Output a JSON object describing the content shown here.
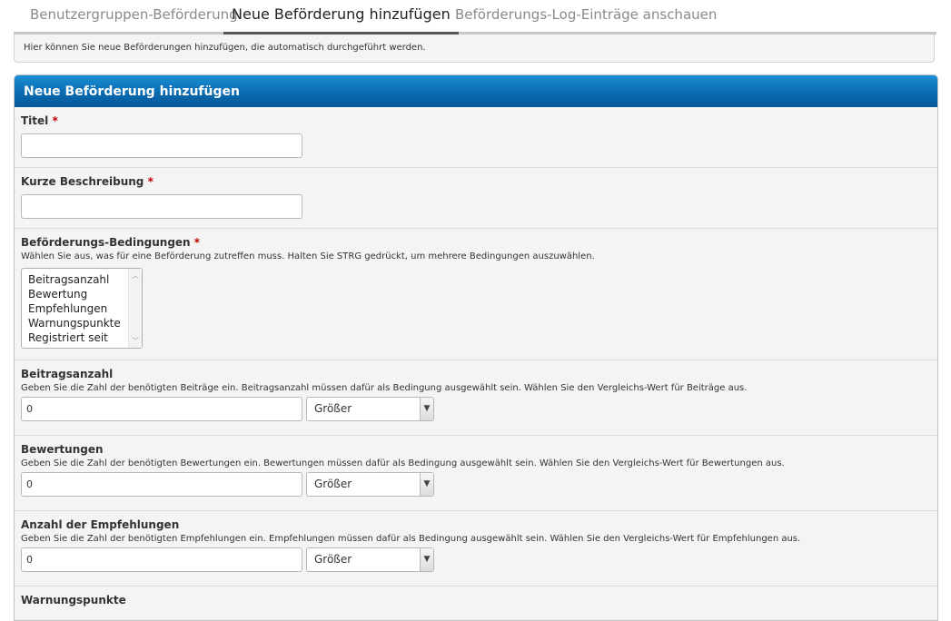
{
  "tabs": [
    {
      "label": "Benutzergruppen-Beförderung"
    },
    {
      "label": "Neue Beförderung hinzufügen"
    },
    {
      "label": "Beförderungs-Log-Einträge anschauen"
    }
  ],
  "info_text": "Hier können Sie neue Beförderungen hinzufügen, die automatisch durchgeführt werden.",
  "panel": {
    "title": "Neue Beförderung hinzufügen",
    "required_mark": "*",
    "fields": {
      "title": {
        "label": "Titel",
        "value": ""
      },
      "short_description": {
        "label": "Kurze Beschreibung",
        "value": ""
      },
      "conditions": {
        "label": "Beförderungs-Bedingungen",
        "description": "Wählen Sie aus, was für eine Beförderung zutreffen muss. Halten Sie STRG gedrückt, um mehrere Bedingungen auszuwählen.",
        "options": [
          "Beitragsanzahl",
          "Bewertung",
          "Empfehlungen",
          "Warnungspunkte",
          "Registriert seit"
        ]
      },
      "post_count": {
        "label": "Beitragsanzahl",
        "description": "Geben Sie die Zahl der benötigten Beiträge ein. Beitragsanzahl müssen dafür als Bedingung ausgewählt sein. Wählen Sie den Vergleichs-Wert für Beiträge aus.",
        "value": "0",
        "comparison": "Größer"
      },
      "ratings": {
        "label": "Bewertungen",
        "description": "Geben Sie die Zahl der benötigten Bewertungen ein. Bewertungen müssen dafür als Bedingung ausgewählt sein. Wählen Sie den Vergleichs-Wert für Bewertungen aus.",
        "value": "0",
        "comparison": "Größer"
      },
      "referrals": {
        "label": "Anzahl der Empfehlungen",
        "description": "Geben Sie die Zahl der benötigten Empfehlungen ein. Empfehlungen müssen dafür als Bedingung ausgewählt sein. Wählen Sie den Vergleichs-Wert für Empfehlungen aus.",
        "value": "0",
        "comparison": "Größer"
      },
      "warning_points": {
        "label": "Warnungspunkte"
      }
    }
  },
  "icons": {
    "select_arrow": "chevron-down-icon",
    "scroll_up": "scroll-up-icon",
    "scroll_down": "scroll-down-icon"
  },
  "colors": {
    "header_blue": "#0a6ab0",
    "required_red": "#c00000",
    "panel_bg": "#f4f4f4"
  }
}
